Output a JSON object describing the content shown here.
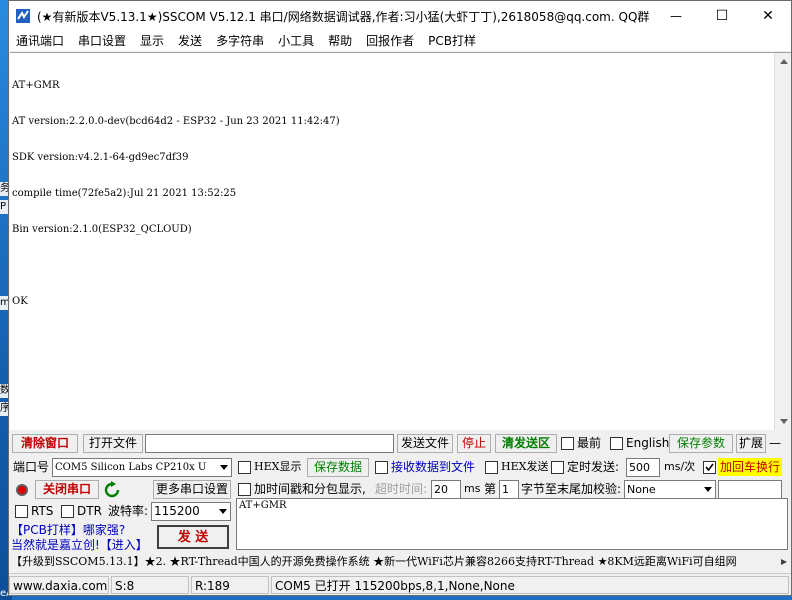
{
  "window": {
    "title": "(★有新版本V5.13.1★)SSCOM V5.12.1 串口/网络数据调试器,作者:习小猛(大虾丁丁),2618058@qq.com. QQ群: 52502449(最新版本)",
    "minimize_glyph": "—",
    "maximize_glyph": "☐",
    "close_glyph": "✕"
  },
  "menu": [
    "通讯端口",
    "串口设置",
    "显示",
    "发送",
    "多字符串",
    "小工具",
    "帮助",
    "回报作者",
    "PCB打样"
  ],
  "terminal": {
    "lines": [
      "AT+GMR",
      "AT version:2.2.0.0-dev(bcd64d2 - ESP32 - Jun 23 2021 11:42:47)",
      "SDK version:v4.2.1-64-gd9ec7df39",
      "compile time(72fe5a2):Jul 21 2021 13:52:25",
      "Bin version:2.1.0(ESP32_QCLOUD)",
      "",
      "OK"
    ]
  },
  "toolbar": {
    "clear_window": "清除窗口",
    "open_file": "打开文件",
    "file_path": "",
    "send_file": "发送文件",
    "stop": "停止",
    "clear_send": "清发送区",
    "topmost": "最前",
    "english": "English",
    "save_params": "保存参数",
    "expand": "扩展",
    "collapse": "—"
  },
  "controls": {
    "port_label": "端口号",
    "port_value": "COM5 Silicon Labs CP210x U",
    "hex_display": "HEX显示",
    "save_data": "保存数据",
    "recv_to_file": "接收数据到文件",
    "hex_send": "HEX发送",
    "timed_send": "定时发送:",
    "interval_value": "500",
    "interval_unit": "ms/次",
    "append_crlf": "加回车换行",
    "close_port": "关闭串口",
    "more_settings": "更多串口设置",
    "timestamp": "加时间戳和分包显示,",
    "timeout_label": "超时时间:",
    "timeout_value": "20",
    "timeout_unit": "ms",
    "frame_prefix": "第",
    "frame_value": "1",
    "checksum_label": "字节至末尾加校验:",
    "checksum_value": "None",
    "rts": "RTS",
    "dtr": "DTR",
    "baud_label": "波特率:",
    "baud_value": "115200",
    "send_button": "发 送",
    "send_text": "AT+GMR",
    "promo_line1": "【PCB打样】哪家强?",
    "promo_line2": "当然就是嘉立创!【进入】"
  },
  "ticker": "【升级到SSCOM5.13.1】★2. ★RT-Thread中国人的开源免费操作系统 ★新一代WiFi芯片兼容8266支持RT-Thread ★8KM远距离WiFi可自组网",
  "status": {
    "site": "www.daxia.com",
    "sent": "S:8",
    "received": "R:189",
    "port_info": "COM5 已打开  115200bps,8,1,None,None"
  },
  "desktop": {
    "frag_a": "务",
    "frag_b": "P",
    "frag_c": "m",
    "frag_d": "数",
    "frag_e": "序",
    "bottom_text": "eAssist"
  },
  "colors": {
    "accent_red": "#c00000",
    "accent_green": "#007f00",
    "accent_blue": "#0000c0",
    "highlight_yellow": "#ffff00"
  }
}
